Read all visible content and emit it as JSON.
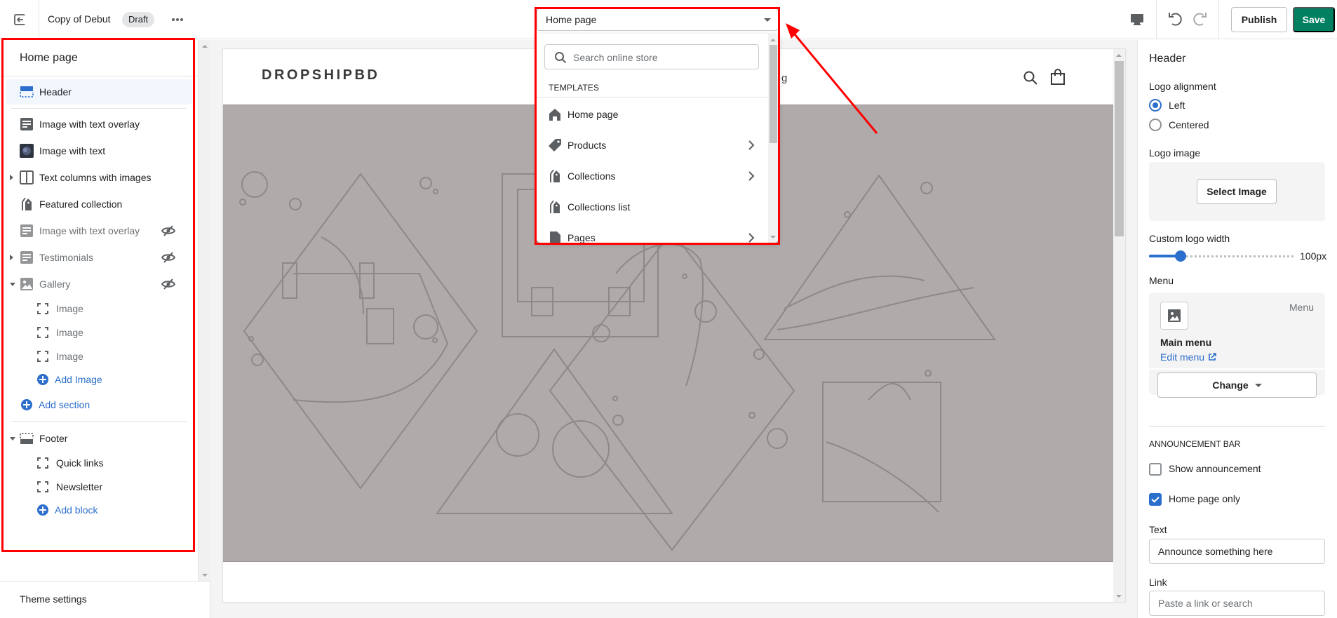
{
  "topbar": {
    "theme_name": "Copy of Debut",
    "status_badge": "Draft",
    "publish_label": "Publish",
    "save_label": "Save",
    "colors": {
      "save": "#008060",
      "accent": "#2c6ecb"
    }
  },
  "page_selector": {
    "selected": "Home page",
    "search_placeholder": "Search online store",
    "section_heading": "TEMPLATES",
    "items": [
      {
        "label": "Home page",
        "icon": "home-icon",
        "has_submenu": false
      },
      {
        "label": "Products",
        "icon": "tag-icon",
        "has_submenu": true
      },
      {
        "label": "Collections",
        "icon": "collections-icon",
        "has_submenu": true
      },
      {
        "label": "Collections list",
        "icon": "collections-icon",
        "has_submenu": false
      },
      {
        "label": "Pages",
        "icon": "page-icon",
        "has_submenu": true
      }
    ]
  },
  "sidebar": {
    "title": "Home page",
    "header_section": "Header",
    "sections": [
      {
        "label": "Image with text overlay",
        "icon": "text-block-icon",
        "hidden": false,
        "expandable": false
      },
      {
        "label": "Image with text",
        "icon": "image-thumbnail-icon",
        "hidden": false,
        "expandable": false
      },
      {
        "label": "Text columns with images",
        "icon": "columns-icon",
        "hidden": false,
        "expandable": true
      },
      {
        "label": "Featured collection",
        "icon": "collections-icon",
        "hidden": false,
        "expandable": false
      },
      {
        "label": "Image with text overlay",
        "icon": "text-block-icon",
        "hidden": true,
        "expandable": false
      },
      {
        "label": "Testimonials",
        "icon": "text-block-icon",
        "hidden": true,
        "expandable": true
      },
      {
        "label": "Gallery",
        "icon": "image-icon",
        "hidden": true,
        "expandable": true,
        "expanded": true
      }
    ],
    "gallery_blocks": [
      "Image",
      "Image",
      "Image"
    ],
    "add_image": "Add Image",
    "add_section": "Add section",
    "footer_section": "Footer",
    "footer_blocks": [
      "Quick links",
      "Newsletter"
    ],
    "add_block": "Add block",
    "theme_settings": "Theme settings"
  },
  "preview": {
    "store_logo": "DROPSHIPBD",
    "nav_fragment": "g"
  },
  "settings": {
    "title": "Header",
    "logo_alignment_label": "Logo alignment",
    "logo_alignment_options": [
      "Left",
      "Centered"
    ],
    "logo_alignment_selected": "Left",
    "logo_image_label": "Logo image",
    "select_image_label": "Select Image",
    "custom_logo_width_label": "Custom logo width",
    "custom_logo_width_value": "100px",
    "custom_logo_width_fraction": 0.22,
    "menu_label": "Menu",
    "menu_type": "Menu",
    "menu_name": "Main menu",
    "edit_menu": "Edit menu",
    "change_label": "Change",
    "announcement_heading": "ANNOUNCEMENT BAR",
    "show_announcement_label": "Show announcement",
    "show_announcement": false,
    "home_page_only_label": "Home page only",
    "home_page_only": true,
    "text_label": "Text",
    "text_value": "Announce something here",
    "link_label": "Link",
    "link_placeholder": "Paste a link or search"
  }
}
